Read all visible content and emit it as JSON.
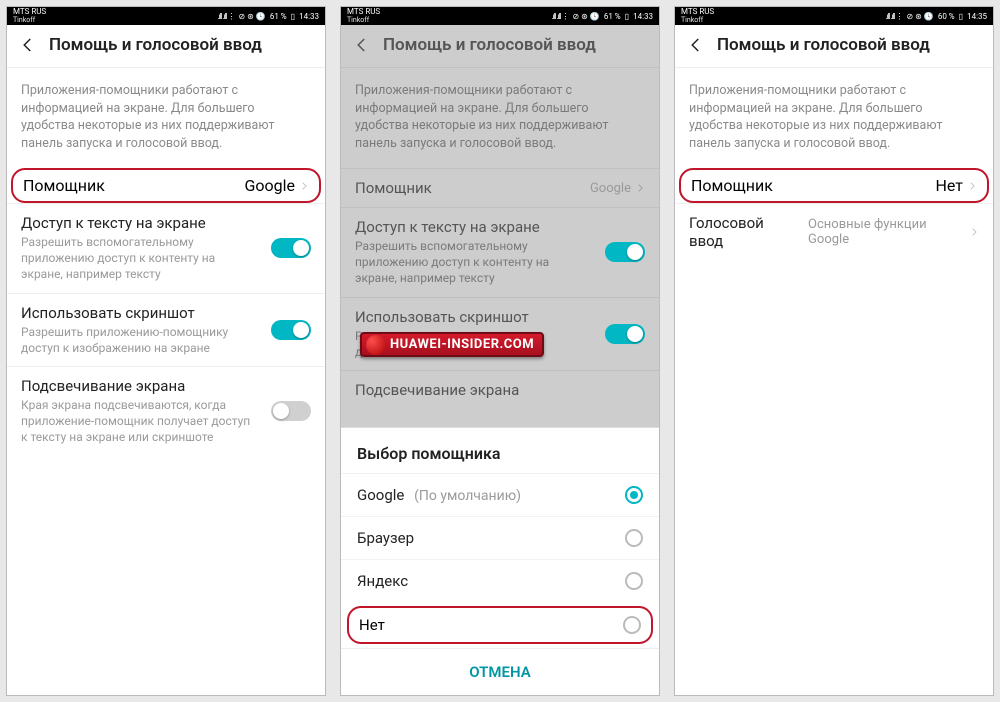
{
  "status": {
    "carrier1": "MTS RUS",
    "carrier2": "Tinkoff",
    "signal": ".ıll .ıll ⋮",
    "icons": "⊘ ⊛ 🕓",
    "battery1": "61 %",
    "battery3": "60 %",
    "rect": "▯",
    "time1": "14:33",
    "time3": "14:35"
  },
  "header": {
    "title": "Помощь и голосовой ввод"
  },
  "desc": "Приложения-помощники работают с информацией на экране. Для большего удобства некоторые из них поддерживают панель запуска и голосовой ввод.",
  "rows": {
    "assistant": {
      "title": "Помощник",
      "value_google": "Google",
      "value_none": "Нет"
    },
    "screen_text": {
      "title": "Доступ к тексту на экране",
      "sub": "Разрешить вспомогательному приложению доступ к контенту на экране, например тексту"
    },
    "screenshot": {
      "title": "Использовать скриншот",
      "sub": "Разрешить приложению-помощнику доступ к изображению на экране",
      "sub_short": "Ра\nдо"
    },
    "flash": {
      "title": "Подсвечивание экрана",
      "sub": "Края экрана подсвечиваются, когда приложение-помощник получает доступ к тексту на экране или скриншоте"
    },
    "voice_input": {
      "title": "Голосовой ввод",
      "value": "Основные функции Google"
    }
  },
  "sheet": {
    "title": "Выбор помощника",
    "opt_google": "Google",
    "default_label": "(По умолчанию)",
    "opt_browser": "Браузер",
    "opt_yandex": "Яндекс",
    "opt_none": "Нет",
    "cancel": "ОТМЕНА"
  },
  "watermark": "HUAWEI-INSIDER.COM"
}
